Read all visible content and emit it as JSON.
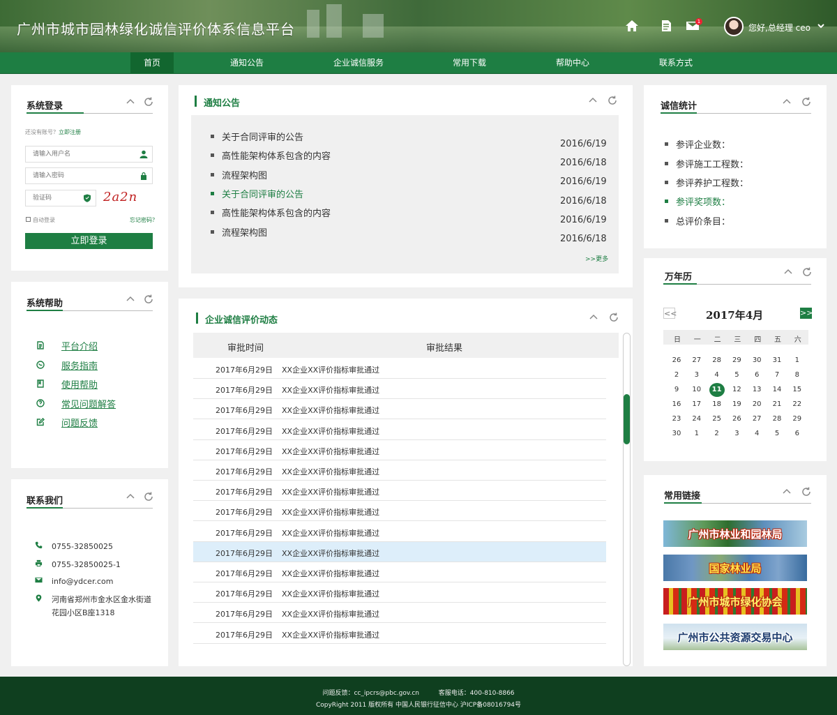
{
  "header": {
    "site_title": "广州市城市园林绿化诚信评价体系信息平台",
    "icons": [
      "home-icon",
      "document-icon",
      "mail-icon"
    ],
    "mail_badge": "1",
    "greeting": "您好,总经理 ceo"
  },
  "nav": [
    "首页",
    "通知公告",
    "企业诚信服务",
    "常用下载",
    "帮助中心",
    "联系方式"
  ],
  "login": {
    "title": "系统登录",
    "register_prompt": "还没有账号？",
    "register_link": "立即注册",
    "username_placeholder": "请输入用户名",
    "password_placeholder": "请输入密码",
    "captcha_placeholder": "验证码",
    "captcha_text": "2a2n",
    "remember_label": "自动登录",
    "forgot_label": "忘记密码？",
    "submit_label": "立即登录"
  },
  "help": {
    "title": "系统帮助",
    "items": [
      "平台介绍",
      "服务指南",
      "使用帮助",
      "常见问题解答",
      "问题反馈"
    ]
  },
  "contact": {
    "title": "联系我们",
    "phone": "0755-32850025",
    "fax": "0755-32850025-1",
    "email": "info@ydcer.com",
    "address": "河南省郑州市金水区金水街道花园小区B座1318"
  },
  "notices": {
    "title": "通知公告",
    "items": [
      {
        "text": "关于合同评审的公告"
      },
      {
        "text": "高性能架构体系包含的内容"
      },
      {
        "text": "流程架构图"
      },
      {
        "text": "关于合同评审的公告"
      },
      {
        "text": "高性能架构体系包含的内容"
      },
      {
        "text": "流程架构图"
      }
    ],
    "dates": [
      "2016/6/19",
      "2016/6/18",
      "2016/6/19",
      "2016/6/18",
      "2016/6/19",
      "2016/6/18"
    ],
    "more": ">>更多"
  },
  "dynamics": {
    "title": "企业诚信评价动态",
    "col_time": "审批时间",
    "col_result": "审批结果",
    "rows": [
      {
        "date": "2017年6月29日",
        "result": "XX企业XX评价指标审批通过"
      },
      {
        "date": "2017年6月29日",
        "result": "XX企业XX评价指标审批通过"
      },
      {
        "date": "2017年6月29日",
        "result": "XX企业XX评价指标审批通过"
      },
      {
        "date": "2017年6月29日",
        "result": "XX企业XX评价指标审批通过"
      },
      {
        "date": "2017年6月29日",
        "result": "XX企业XX评价指标审批通过"
      },
      {
        "date": "2017年6月29日",
        "result": "XX企业XX评价指标审批通过"
      },
      {
        "date": "2017年6月29日",
        "result": "XX企业XX评价指标审批通过"
      },
      {
        "date": "2017年6月29日",
        "result": "XX企业XX评价指标审批通过"
      },
      {
        "date": "2017年6月29日",
        "result": "XX企业XX评价指标审批通过"
      },
      {
        "date": "2017年6月29日",
        "result": "XX企业XX评价指标审批通过"
      },
      {
        "date": "2017年6月29日",
        "result": "XX企业XX评价指标审批通过"
      },
      {
        "date": "2017年6月29日",
        "result": "XX企业XX评价指标审批通过"
      },
      {
        "date": "2017年6月29日",
        "result": "XX企业XX评价指标审批通过"
      },
      {
        "date": "2017年6月29日",
        "result": "XX企业XX评价指标审批通过"
      }
    ]
  },
  "stats": {
    "title": "诚信统计",
    "items": [
      "参评企业数：",
      "参评施工工程数：",
      "参评养护工程数：",
      "参评奖项数：",
      "总评价条目："
    ]
  },
  "calendar": {
    "title": "万年历",
    "prev": "<<",
    "next": ">>",
    "month_label": "2017年4月",
    "weekdays": [
      "日",
      "一",
      "二",
      "三",
      "四",
      "五",
      "六"
    ],
    "days": [
      "26",
      "27",
      "28",
      "29",
      "30",
      "31",
      "1",
      "2",
      "3",
      "4",
      "5",
      "6",
      "7",
      "8",
      "9",
      "10",
      "11",
      "12",
      "13",
      "14",
      "15",
      "16",
      "17",
      "18",
      "19",
      "20",
      "21",
      "22",
      "23",
      "24",
      "25",
      "26",
      "27",
      "28",
      "29",
      "30",
      "1",
      "2",
      "3",
      "4",
      "5",
      "6"
    ],
    "today": "11"
  },
  "links": {
    "title": "常用链接",
    "items": [
      "广州市林业和园林局",
      "国家林业局",
      "广州市城市绿化协会",
      "广州市公共资源交易中心"
    ]
  },
  "footer": {
    "feedback": "问题反馈：cc_ipcrs@pbc.gov.cn",
    "hotline": "客服电话：400-810-8866",
    "copyright": "CopyRight 2011 版权所有   中国人民银行征信中心   沪ICP备08016794号"
  },
  "colors": {
    "brand": "#1e7e43",
    "highlight_row": "#ddeefa",
    "footer": "#0f3f1f"
  }
}
